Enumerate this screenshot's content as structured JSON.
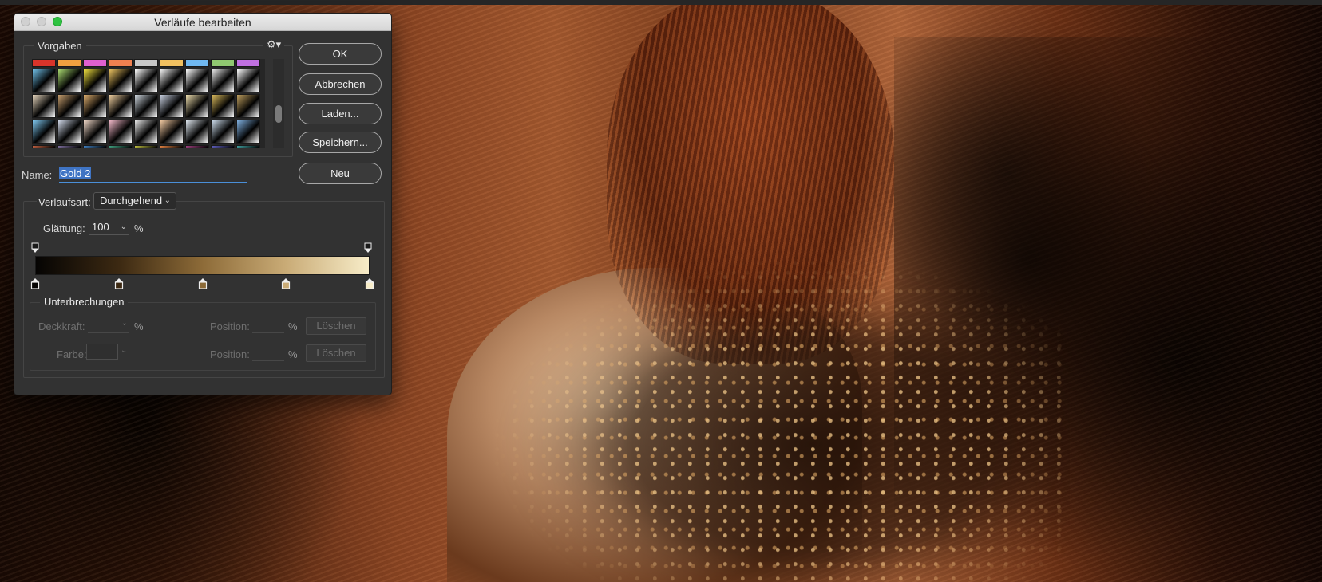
{
  "dialog": {
    "title": "Verläufe bearbeiten",
    "presets_label": "Vorgaben",
    "gear_symbol": "⚙▾",
    "swatches": [
      [
        "#d8342a",
        "#f0a040",
        "#e060d0",
        "#f08050",
        "#c8c8c8",
        "#f0c060",
        "#70b8f0",
        "#90c870",
        "#c070e0"
      ],
      [
        "#70c0e8",
        "#a8d870",
        "#f0e040",
        "#e8c060",
        "#ffffff",
        "#f0f0f0",
        "#ffffff",
        "#f0f0f0",
        "#ffffff"
      ],
      [
        "#e8d8c0",
        "#c8a070",
        "#e0b070",
        "#f0d0a0",
        "#d0d8e0",
        "#c8d0e0",
        "#f0e0b0",
        "#e0c060",
        "#c0a060"
      ],
      [
        "#80c8f0",
        "#d0d8e8",
        "#f0d8c8",
        "#f0b8c8",
        "#e8e8e8",
        "#f0c8a0",
        "#e0e8f0",
        "#d0e0f0",
        "#80b0e0"
      ],
      [
        "#c06040",
        "#8070a0",
        "#4080c0",
        "#40a080",
        "#c0c040",
        "#e08040",
        "#a04080",
        "#6060c0",
        "#40a0a0"
      ]
    ],
    "buttons": {
      "ok": "OK",
      "cancel": "Abbrechen",
      "load": "Laden...",
      "save": "Speichern...",
      "new": "Neu"
    },
    "name_label": "Name:",
    "name_value": "Gold 2",
    "gradient_type_label": "Verlaufsart:",
    "gradient_type_value": "Durchgehend",
    "smoothness_label": "Glättung:",
    "smoothness_value": "100",
    "percent": "%",
    "gradient_colors": [
      "#050403",
      "#3c2912",
      "#8d6b38",
      "#c9ab76",
      "#f7ecc8"
    ],
    "stops_label": "Unterbrechungen",
    "opacity_label": "Deckkraft:",
    "color_label": "Farbe:",
    "position_label": "Position:",
    "delete_label": "Löschen"
  }
}
